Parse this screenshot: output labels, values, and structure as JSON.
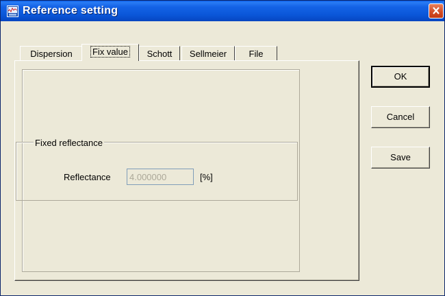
{
  "window": {
    "title": "Reference setting"
  },
  "tabs": [
    {
      "label": "Dispersion",
      "active": false
    },
    {
      "label": "Fix value",
      "active": true
    },
    {
      "label": "Schott",
      "active": false
    },
    {
      "label": "Sellmeier",
      "active": false
    },
    {
      "label": "File",
      "active": false
    }
  ],
  "fixed_reflectance": {
    "group_title": "Fixed reflectance",
    "label": "Reflectance",
    "value": "4.000000",
    "unit": "[%]",
    "enabled": false
  },
  "buttons": {
    "ok": "OK",
    "cancel": "Cancel",
    "save": "Save"
  },
  "icons": {
    "app": "chart-icon",
    "close": "close-icon"
  },
  "colors": {
    "titlebar": "#0a56d8",
    "close_button": "#d24a24",
    "face": "#ece9d8"
  }
}
